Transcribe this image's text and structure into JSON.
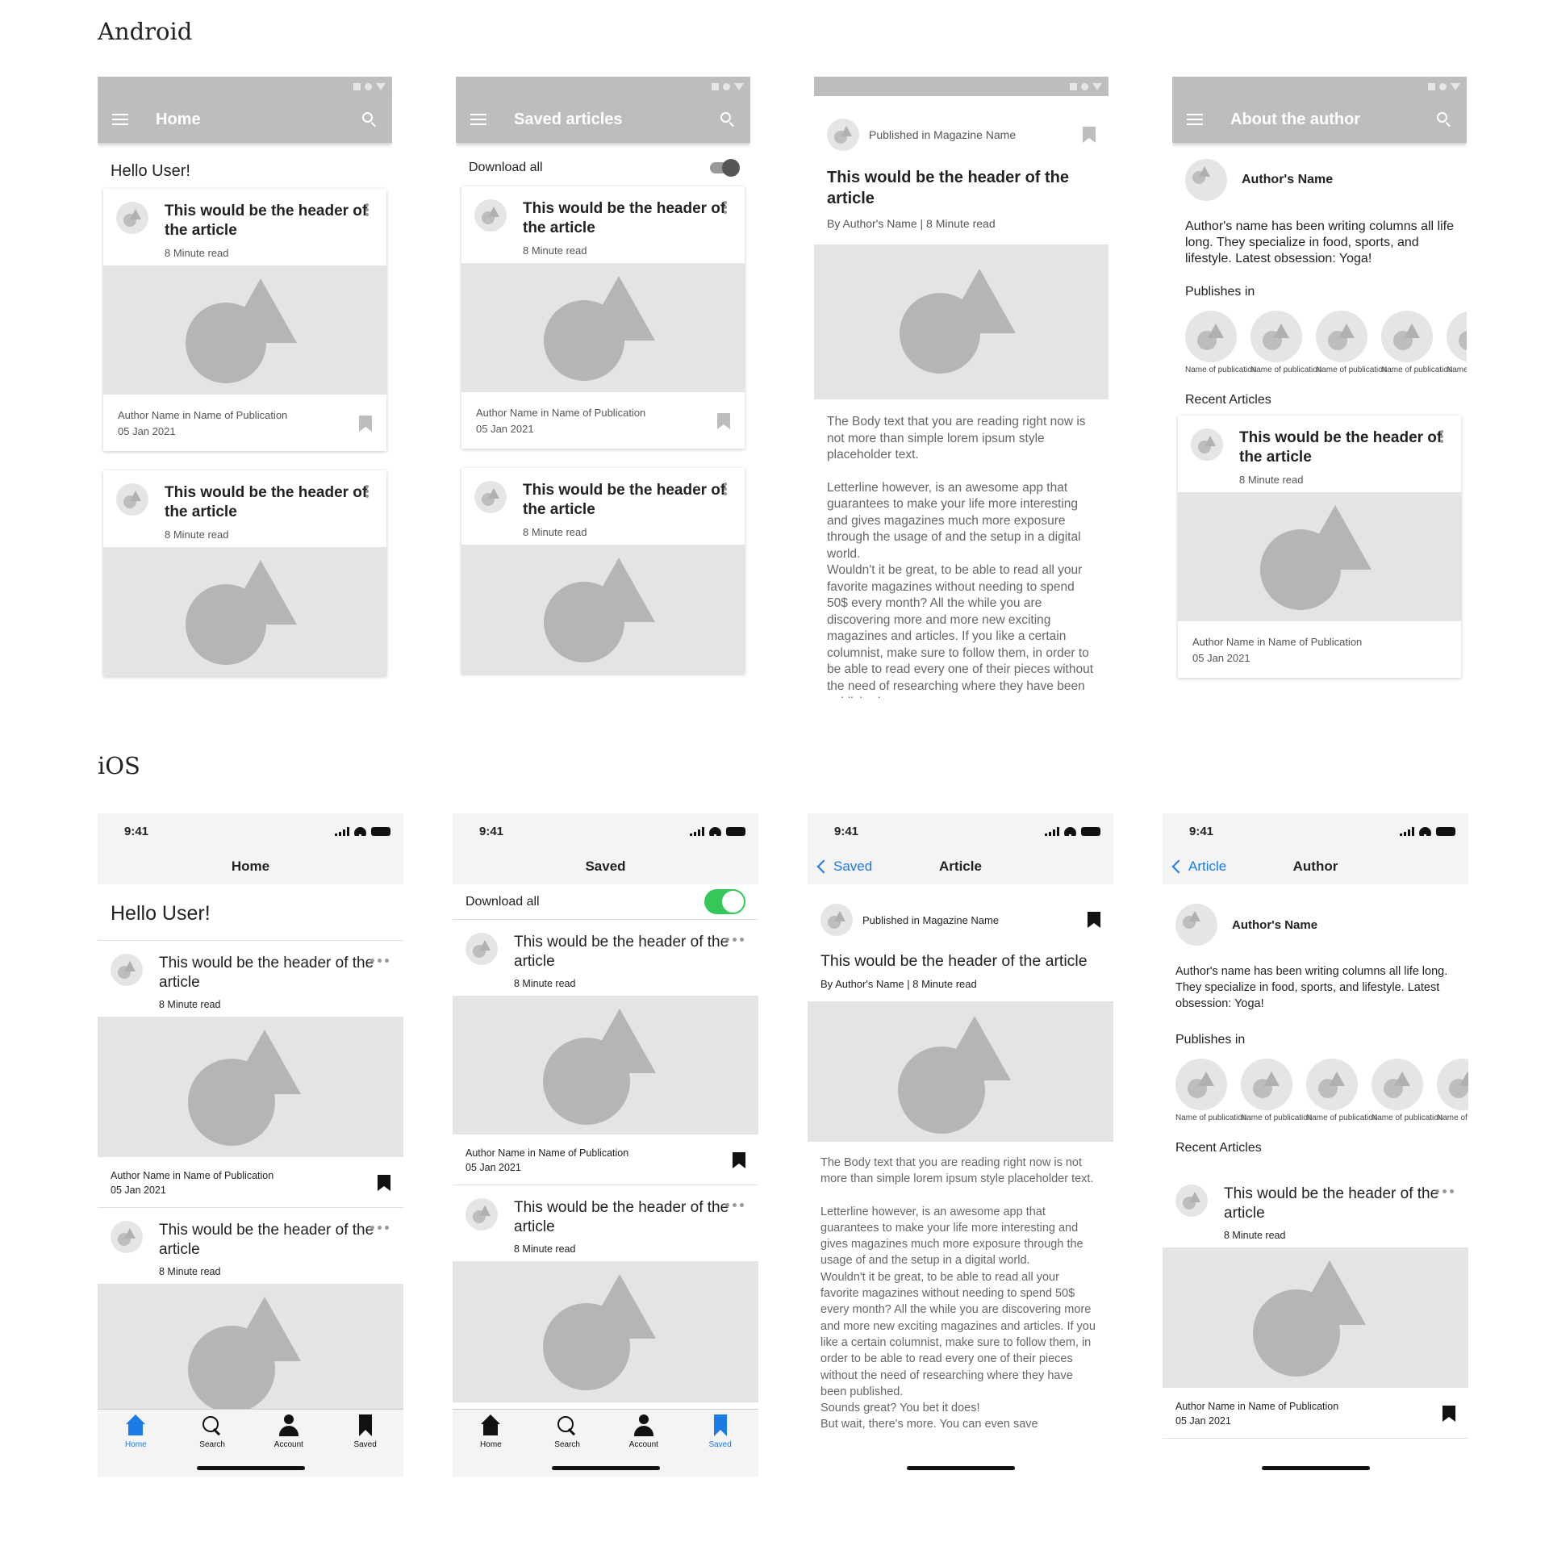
{
  "android": {
    "section_title": "Android",
    "home": {
      "title": "Home",
      "greeting": "Hello User!",
      "cards": [
        {
          "header": "This would be the header of the article",
          "read_time": "8 Minute read",
          "author": "Author Name in Name of Publication",
          "date": "05 Jan 2021"
        },
        {
          "header": "This would be the header of the article",
          "read_time": "8 Minute read"
        }
      ]
    },
    "saved": {
      "title": "Saved articles",
      "download_all": "Download all",
      "cards": [
        {
          "header": "This would be the header of the article",
          "read_time": "8 Minute read",
          "author": "Author Name in Name of Publication",
          "date": "05 Jan 2021"
        },
        {
          "header": "This would be the header of the article",
          "read_time": "8 Minute read"
        }
      ]
    },
    "article": {
      "published_in": "Published in Magazine Name",
      "title": "This would be the header of the article",
      "byline": "By Author's Name | 8 Minute read",
      "body_1": "The Body text that you are reading right now is not more than simple lorem ipsum style placeholder text.",
      "body_2": "Letterline however, is an awesome app that guarantees to make your life more interesting and gives magazines much more exposure through the usage of and the setup in a digital world.",
      "body_3": "Wouldn't it be great, to be able to read all your favorite magazines without needing to spend 50$ every month? All the while you are discovering more and more new exciting magazines and articles. If you like a certain columnist, make sure to follow them, in order to be able to read every one of their pieces without the need of researching where they have been published."
    },
    "author": {
      "title": "About the author",
      "name": "Author's Name",
      "bio": "Author's name has been writing columns all life long. They specialize in food, sports, and lifestyle. Latest obsession: Yoga!",
      "publishes_in": "Publishes in",
      "publications": [
        "Name of publication",
        "Name of publication",
        "Name of publication",
        "Name of publication",
        "Name of publication"
      ],
      "recent_articles": "Recent Articles",
      "card": {
        "header": "This would be the header of the article",
        "read_time": "8 Minute read",
        "author": "Author Name in Name of Publication",
        "date": "05 Jan 2021"
      }
    }
  },
  "ios": {
    "section_title": "iOS",
    "time": "9:41",
    "tabs": {
      "home": "Home",
      "search": "Search",
      "account": "Account",
      "saved": "Saved"
    },
    "home": {
      "title": "Home",
      "greeting": "Hello User!",
      "cards": [
        {
          "header": "This would be the header of the article",
          "read_time": "8 Minute read",
          "author": "Author Name in Name of Publication",
          "date": "05 Jan 2021"
        },
        {
          "header": "This would be the header of the article",
          "read_time": "8 Minute read"
        }
      ]
    },
    "saved": {
      "title": "Saved",
      "download_all": "Download all",
      "download_all_on": true,
      "cards": [
        {
          "header": "This would be the header of the article",
          "read_time": "8 Minute read",
          "author": "Author Name in Name of Publication",
          "date": "05 Jan 2021"
        },
        {
          "header": "This would be the header of the article",
          "read_time": "8 Minute read"
        }
      ]
    },
    "article": {
      "back": "Saved",
      "title": "Article",
      "published_in": "Published in Magazine Name",
      "header": "This would be the header of the article",
      "byline": "By Author's Name | 8 Minute read",
      "body_1": "The Body text that you are reading right now is not more than simple lorem ipsum style placeholder text.",
      "body_2": "Letterline however, is an awesome app that guarantees to make your life more interesting and gives magazines much more exposure through the usage of and the setup in a digital world.",
      "body_3": "Wouldn't it be great, to be able to read all your favorite magazines without needing to spend 50$ every month? All the while you are discovering more and more new exciting magazines and articles. If you like a certain columnist, make sure to follow them, in order to be able to read every one of their pieces without the need of researching where they have been published.",
      "body_4": "Sounds great? You bet it does!",
      "body_5": "But wait, there's more. You can even save"
    },
    "author": {
      "back": "Article",
      "title": "Author",
      "name": "Author's Name",
      "bio": "Author's name has been writing columns all life long. They specialize in food, sports, and lifestyle. Latest obsession: Yoga!",
      "publishes_in": "Publishes in",
      "publications": [
        "Name of publication",
        "Name of publication",
        "Name of publication",
        "Name of publication",
        "Name of publication"
      ],
      "recent_articles": "Recent Articles",
      "card": {
        "header": "This would be the header of the article",
        "read_time": "8 Minute read",
        "author": "Author Name in Name of Publication",
        "date": "05 Jan 2021"
      }
    }
  },
  "colors": {
    "ios_accent": "#1a7ae6",
    "switch_on": "#34c759",
    "appbar": "#bdbdbd"
  }
}
